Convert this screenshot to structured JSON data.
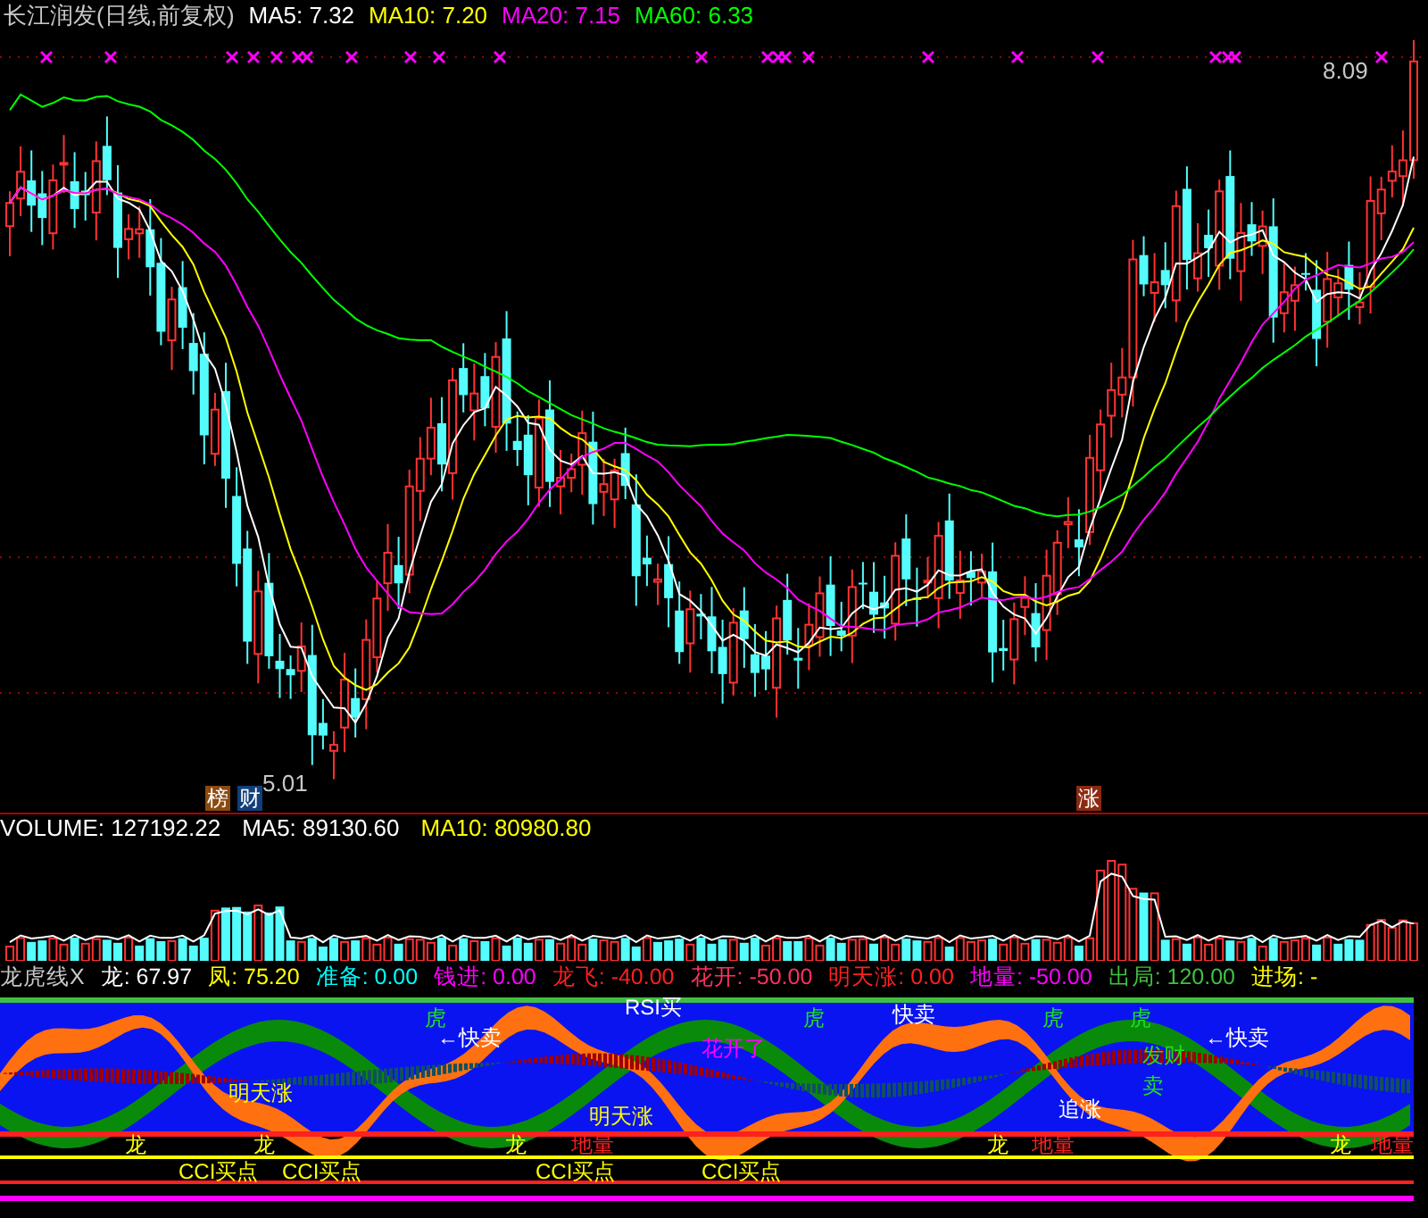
{
  "chart_title": "长江润发(日线,前复权)",
  "price_legend": [
    {
      "label": "MA5: 7.32",
      "color": "#ffffff"
    },
    {
      "label": "MA10: 7.20",
      "color": "#ffff00"
    },
    {
      "label": "MA20: 7.15",
      "color": "#ff00ff"
    },
    {
      "label": "MA60: 6.33",
      "color": "#00ff00"
    }
  ],
  "price_labels": {
    "high": "8.09",
    "low": "5.01"
  },
  "badges": [
    {
      "text": "榜",
      "color": "#8b4a10"
    },
    {
      "text": "财",
      "color": "#123f7a"
    },
    {
      "text": "涨",
      "color": "#8b2a10"
    }
  ],
  "volume_legend": [
    {
      "label": "VOLUME: 127192.22",
      "color": "#ffffff"
    },
    {
      "label": "MA5: 89130.60",
      "color": "#ffffff"
    },
    {
      "label": "MA10: 80980.80",
      "color": "#ffff00"
    }
  ],
  "indicator_title": "龙虎线X",
  "indicator_legend": [
    {
      "label": "龙: 67.97",
      "color": "#ffffff"
    },
    {
      "label": "凤: 75.20",
      "color": "#ffff00"
    },
    {
      "label": "准备: 0.00",
      "color": "#00ffff"
    },
    {
      "label": "钱进: 0.00",
      "color": "#ff00ff"
    },
    {
      "label": "龙飞: -40.00",
      "color": "#ff2020"
    },
    {
      "label": "花开: -50.00",
      "color": "#ff3060"
    },
    {
      "label": "明天涨: 0.00",
      "color": "#ff2020"
    },
    {
      "label": "地量: -50.00",
      "color": "#ff00ff"
    },
    {
      "label": "出局: 120.00",
      "color": "#40c040"
    },
    {
      "label": "进场: -",
      "color": "#ffff00"
    }
  ],
  "signals": [
    {
      "text": "RSI买",
      "kind": "buy"
    },
    {
      "text": "←快卖",
      "kind": "sell"
    },
    {
      "text": "快卖",
      "kind": "sell"
    },
    {
      "text": "←快卖",
      "kind": "sell"
    },
    {
      "text": "追涨",
      "kind": "sell"
    },
    {
      "text": "花开了",
      "kind": "bloom"
    },
    {
      "text": "明天涨",
      "kind": "rise"
    },
    {
      "text": "明天涨",
      "kind": "rise"
    },
    {
      "text": "虎",
      "kind": "tiger"
    },
    {
      "text": "虎",
      "kind": "tiger"
    },
    {
      "text": "虎",
      "kind": "tiger"
    },
    {
      "text": "虎",
      "kind": "tiger"
    },
    {
      "text": "发财",
      "kind": "tiger"
    },
    {
      "text": "卖",
      "kind": "tiger"
    },
    {
      "text": "龙",
      "kind": "dragon"
    },
    {
      "text": "龙",
      "kind": "dragon"
    },
    {
      "text": "龙",
      "kind": "dragon"
    },
    {
      "text": "龙",
      "kind": "dragon"
    },
    {
      "text": "龙",
      "kind": "dragon"
    },
    {
      "text": "CCI买点",
      "kind": "cci"
    },
    {
      "text": "CCI买点",
      "kind": "cci"
    },
    {
      "text": "CCI买点",
      "kind": "cci"
    },
    {
      "text": "CCI买点",
      "kind": "cci"
    },
    {
      "text": "地量",
      "kind": "low_volume"
    },
    {
      "text": "地量",
      "kind": "low_volume"
    },
    {
      "text": "地量",
      "kind": "low_volume"
    }
  ]
}
